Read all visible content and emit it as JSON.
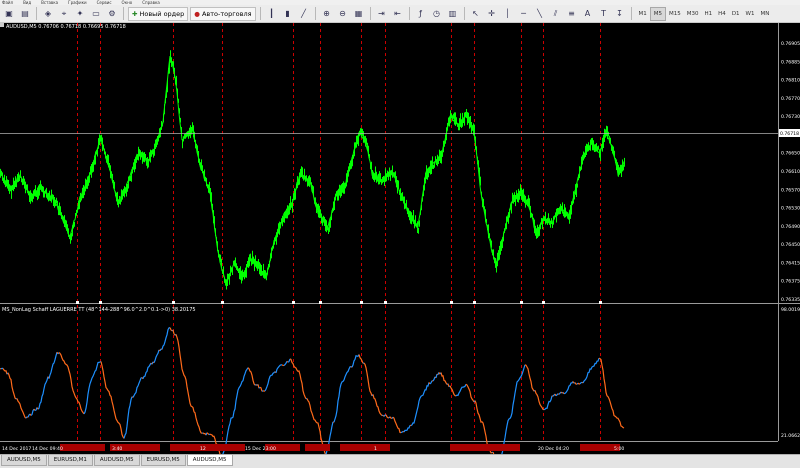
{
  "menu": [
    "Файл",
    "Вид",
    "Вставка",
    "Графики",
    "Сервис",
    "Окно",
    "Справка"
  ],
  "toolbar": {
    "new_order_label": "Новый ордер",
    "autotrading_label": "Авто-торговля",
    "timeframes": [
      "M1",
      "M5",
      "M15",
      "M30",
      "H1",
      "H4",
      "D1",
      "W1",
      "MN"
    ],
    "active_timeframe": "M5"
  },
  "chart": {
    "title": "AUDUSD,M5  0.76706 0.76718 0.76695 0.76718",
    "price_axis": [
      "0.76905",
      "0.76885",
      "0.76810",
      "0.76770",
      "0.76730",
      "0.76690",
      "0.76650",
      "0.76610",
      "0.76570",
      "0.76530",
      "0.76490",
      "0.76450",
      "0.76415",
      "0.76375",
      "0.76335"
    ],
    "current_price": "0.76718",
    "colors": {
      "price_line": "#00ff00",
      "background": "#000000",
      "period_lines": "#ff0000",
      "osc_up": "#1e90ff",
      "osc_down": "#ff6a1a"
    }
  },
  "indicator": {
    "title": "MS_NonLag Schaff LAGUERRE TT (48^144-288^96.0^2.0^0.1->0) 38.20175",
    "axis_top": "98.00197",
    "axis_bottom": "21.06621"
  },
  "time_axis": [
    "14 Dec 2017",
    "14 Dec 09:40",
    "3:40",
    "12",
    "15 Dec 23:00",
    "1",
    "20 Dec 04:20",
    "5:00"
  ],
  "tabs": [
    "AUDUSD,M5",
    "EURUSD,M1",
    "AUDUSD,M5",
    "EURUSD,M5",
    "AUDUSD,M5"
  ],
  "active_tab": 4
}
